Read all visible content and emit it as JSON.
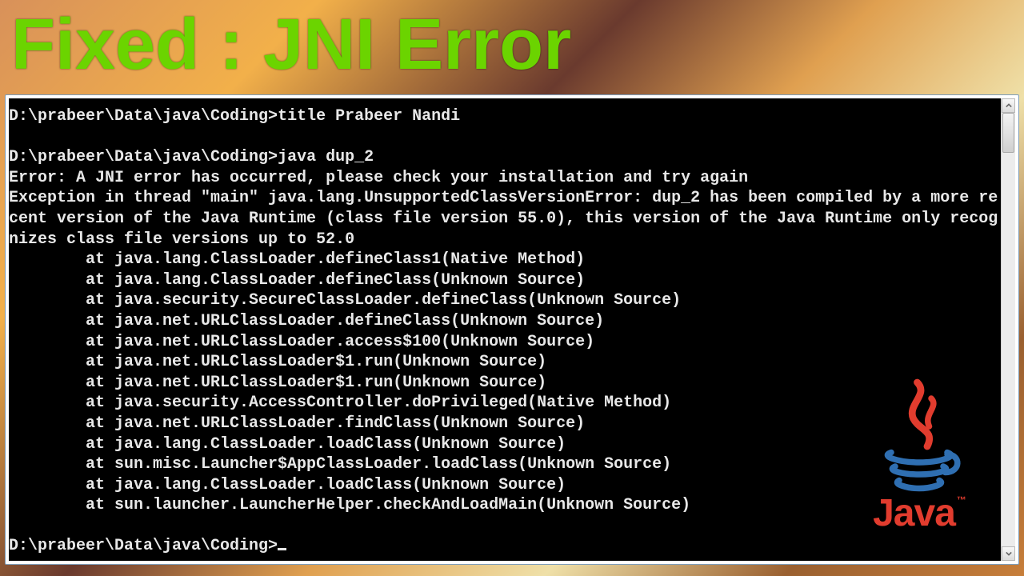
{
  "headline": "Fixed : JNI Error",
  "prompt": "D:\\prabeer\\Data\\java\\Coding>",
  "commands": {
    "cmd1": "title Prabeer Nandi",
    "cmd2": "java dup_2"
  },
  "error_block": "Error: A JNI error has occurred, please check your installation and try again\nException in thread \"main\" java.lang.UnsupportedClassVersionError: dup_2 has been compiled by a more recent version of the Java Runtime (class file version 55.0), this version of the Java Runtime only recognizes class file versions up to 52.0",
  "stack": [
    "        at java.lang.ClassLoader.defineClass1(Native Method)",
    "        at java.lang.ClassLoader.defineClass(Unknown Source)",
    "        at java.security.SecureClassLoader.defineClass(Unknown Source)",
    "        at java.net.URLClassLoader.defineClass(Unknown Source)",
    "        at java.net.URLClassLoader.access$100(Unknown Source)",
    "        at java.net.URLClassLoader$1.run(Unknown Source)",
    "        at java.net.URLClassLoader$1.run(Unknown Source)",
    "        at java.security.AccessController.doPrivileged(Native Method)",
    "        at java.net.URLClassLoader.findClass(Unknown Source)",
    "        at java.lang.ClassLoader.loadClass(Unknown Source)",
    "        at sun.misc.Launcher$AppClassLoader.loadClass(Unknown Source)",
    "        at java.lang.ClassLoader.loadClass(Unknown Source)",
    "        at sun.launcher.LauncherHelper.checkAndLoadMain(Unknown Source)"
  ],
  "java_wordmark": "Java",
  "java_tm": "™",
  "colors": {
    "headline": "#6bd400",
    "term_bg": "#000000",
    "term_fg": "#e8e8e8",
    "java_red": "#e13c2e",
    "java_blue": "#2f6fb2"
  }
}
